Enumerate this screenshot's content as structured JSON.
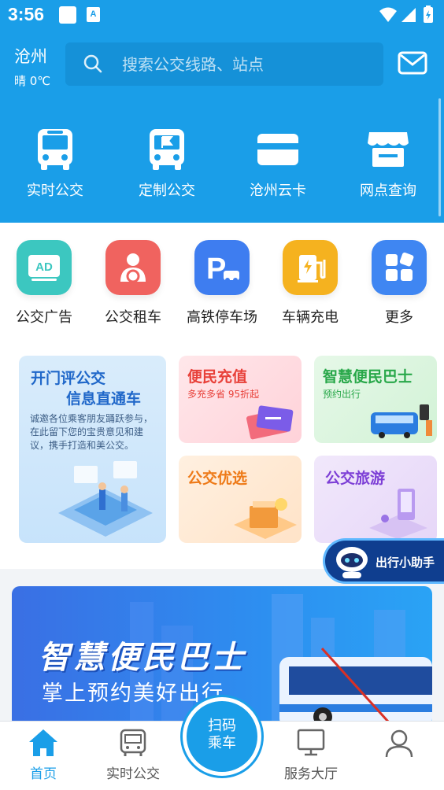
{
  "status": {
    "time": "3:56",
    "notif_a": "A"
  },
  "header": {
    "city": "沧州",
    "weather": "晴 0℃",
    "search_placeholder": "搜索公交线路、站点"
  },
  "top_services": [
    {
      "label": "实时公交",
      "icon": "bus-icon"
    },
    {
      "label": "定制公交",
      "icon": "custom-bus-icon"
    },
    {
      "label": "沧州云卡",
      "icon": "card-icon"
    },
    {
      "label": "网点查询",
      "icon": "store-icon"
    }
  ],
  "secondary_services": [
    {
      "label": "公交广告",
      "icon": "ad-icon",
      "icon_text": "AD",
      "color": "#3cc7c0"
    },
    {
      "label": "公交租车",
      "icon": "driver-icon",
      "color": "#f0635f"
    },
    {
      "label": "高铁停车场",
      "icon": "parking-icon",
      "icon_text": "P",
      "color": "#3e7df0"
    },
    {
      "label": "车辆充电",
      "icon": "charging-icon",
      "color": "#f5b21f"
    },
    {
      "label": "更多",
      "icon": "more-icon",
      "color": "#3f86f2"
    }
  ],
  "promo": {
    "feedback": {
      "title_1": "开门评公交",
      "title_2": "信息直通车",
      "body": "诚邀各位乘客朋友踊跃参与，在此留下您的宝贵意见和建议，携手打造和美公交。"
    },
    "recharge": {
      "title": "便民充值",
      "sub": "多充多省 95折起"
    },
    "smart_bus": {
      "title": "智慧便民巴士",
      "sub": "预约出行"
    },
    "bus_select": {
      "title": "公交优选"
    },
    "bus_travel": {
      "title": "公交旅游"
    }
  },
  "assistant": {
    "label": "出行小助手"
  },
  "banner": {
    "title": "智慧便民巴士",
    "subtitle": "掌上预约美好出行"
  },
  "bottom_nav": {
    "home": "首页",
    "realtime": "实时公交",
    "scan_1": "扫码",
    "scan_2": "乘车",
    "service": "服务大厅"
  },
  "colors": {
    "primary": "#1a9ee8"
  }
}
